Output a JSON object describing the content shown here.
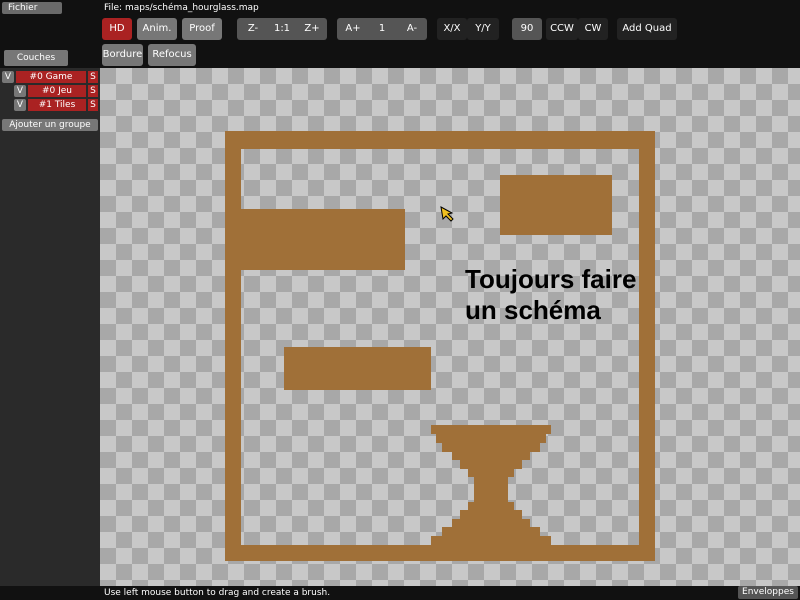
{
  "menu": {
    "file_label": "Fichier"
  },
  "file_path": "File: maps/schéma_hourglass.map",
  "toolbar": {
    "hd": "HD",
    "anim": "Anim.",
    "proof": "Proof",
    "zoom_out": "Z-",
    "zoom_reset": "1:1",
    "zoom_in": "Z+",
    "anim_faster": "A+",
    "anim_speed": "1",
    "anim_slower": "A-",
    "flip_x": "X/X",
    "flip_y": "Y/Y",
    "rotate_value": "90",
    "rotate_ccw": "CCW",
    "rotate_cw": "CW",
    "add_quad": "Add Quad",
    "border": "Bordure",
    "refocus": "Refocus"
  },
  "layers": {
    "tab_label": "Couches",
    "items": [
      {
        "v": "V",
        "name": "#0 Game",
        "s": "S"
      },
      {
        "v": "V",
        "name": "#0 Jeu",
        "s": "S"
      },
      {
        "v": "V",
        "name": "#1 Tiles",
        "s": "S"
      }
    ],
    "add_group": "Ajouter un groupe"
  },
  "canvas": {
    "text_line1": "Toujours faire",
    "text_line2": "un schéma",
    "tile_color": "#a07038"
  },
  "status": {
    "hint": "Use left mouse button to drag and create a brush.",
    "envelopes": "Enveloppes"
  }
}
